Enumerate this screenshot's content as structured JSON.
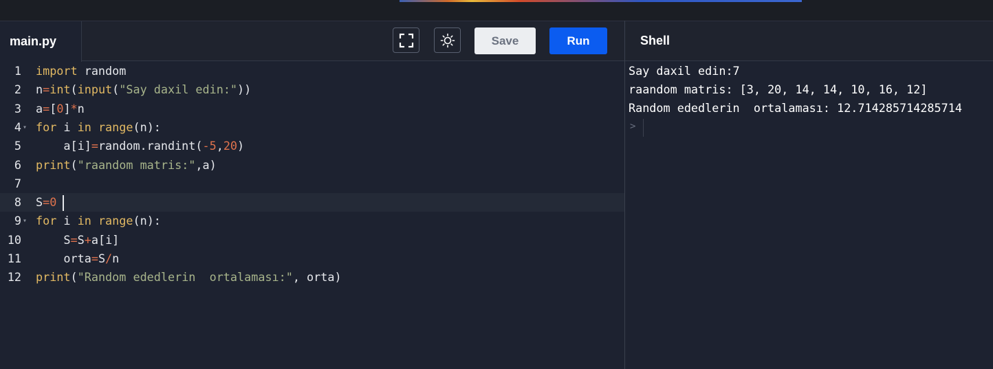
{
  "editor": {
    "filename": "main.py",
    "fullscreen_icon": "fullscreen-icon",
    "theme_icon": "sun-icon",
    "save_label": "Save",
    "run_label": "Run",
    "line_numbers": [
      "1",
      "2",
      "3",
      "4",
      "5",
      "6",
      "7",
      "8",
      "9",
      "10",
      "11",
      "12"
    ],
    "code_lines": [
      "import random",
      "n=int(input(\"Say daxil edin:\"))",
      "a=[0]*n",
      "for i in range(n):",
      "    a[i]=random.randint(-5,20)",
      "print(\"raandom matris:\",a)",
      "",
      "S=0",
      "for i in range(n):",
      "    S=S+a[i]",
      "    orta=S/n",
      "print(\"Random ededlerin  ortalaması:\", orta)"
    ],
    "active_line": 8
  },
  "shell": {
    "title": "Shell",
    "output": [
      "Say daxil edin:7",
      "raandom matris: [3, 20, 14, 14, 10, 16, 12]",
      "Random ededlerin  ortalaması: 12.714285714285714"
    ],
    "prompt": ">"
  },
  "colors": {
    "background": "#1d2230",
    "run_button": "#0b5cf0",
    "keyword": "#e2b963",
    "string": "#a8b58b",
    "number": "#e0734d"
  }
}
